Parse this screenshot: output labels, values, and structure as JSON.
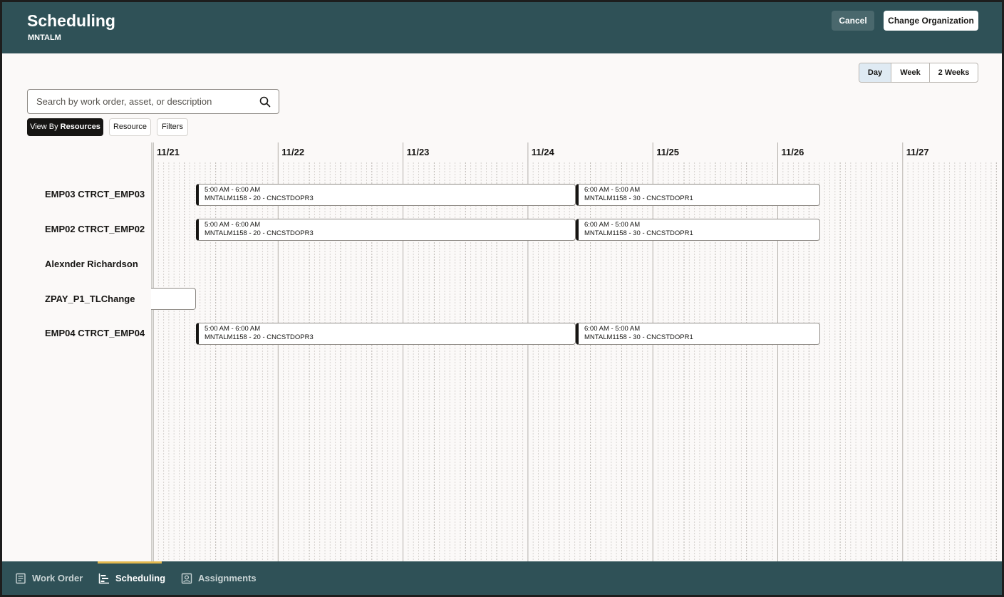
{
  "header": {
    "title": "Scheduling",
    "org_code": "MNTALM",
    "cancel_label": "Cancel",
    "change_org_label": "Change Organization",
    "background": "#2f5157"
  },
  "view_toggle": [
    {
      "label": "Day",
      "active": true
    },
    {
      "label": "Week",
      "active": false
    },
    {
      "label": "2 Weeks",
      "active": false
    }
  ],
  "search": {
    "placeholder": "Search by work order, asset, or description",
    "icon": "search-icon"
  },
  "filters": {
    "view_by_prefix": "View By",
    "view_by_value": "Resources",
    "resource_label": "Resource",
    "filters_label": "Filters"
  },
  "timeline": {
    "dates": [
      "11/21",
      "11/22",
      "11/23",
      "11/24",
      "11/25",
      "11/26",
      "11/27"
    ],
    "resources": [
      {
        "name": "EMP03 CTRCT_EMP03",
        "events": [
          {
            "time": "5:00 AM - 6:00 AM",
            "detail": "MNTALM1158 - 20 - CNCSTDOPR3"
          },
          {
            "time": "6:00 AM - 5:00 AM",
            "detail": "MNTALM1158 - 30 - CNCSTDOPR1"
          }
        ]
      },
      {
        "name": "EMP02 CTRCT_EMP02",
        "events": [
          {
            "time": "5:00 AM - 6:00 AM",
            "detail": "MNTALM1158 - 20 - CNCSTDOPR3"
          },
          {
            "time": "6:00 AM - 5:00 AM",
            "detail": "MNTALM1158 - 30 - CNCSTDOPR1"
          }
        ]
      },
      {
        "name": "Alexnder Richardson",
        "events": []
      },
      {
        "name": "ZPAY_P1_TLChange",
        "events": []
      },
      {
        "name": "EMP04 CTRCT_EMP04",
        "events": [
          {
            "time": "5:00 AM - 6:00 AM",
            "detail": "MNTALM1158 - 20 - CNCSTDOPR3"
          },
          {
            "time": "6:00 AM - 5:00 AM",
            "detail": "MNTALM1158 - 30 - CNCSTDOPR1"
          }
        ]
      }
    ]
  },
  "bottom_nav": [
    {
      "label": "Work Order",
      "icon": "document-icon",
      "active": false
    },
    {
      "label": "Scheduling",
      "icon": "bar-chart-icon",
      "active": true
    },
    {
      "label": "Assignments",
      "icon": "person-badge-icon",
      "active": false
    }
  ],
  "colors": {
    "accent_indicator": "#e3b94f",
    "active_toggle": "#dfeaf3"
  }
}
